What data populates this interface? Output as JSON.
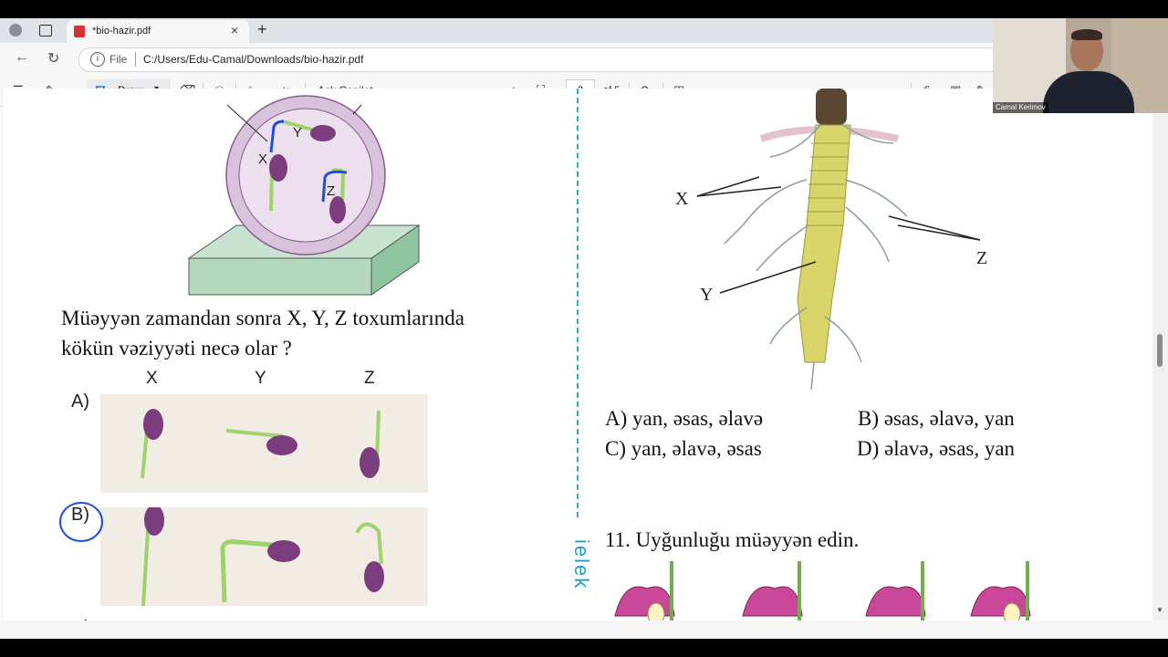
{
  "browser": {
    "tab_title": "*bio-hazir.pdf",
    "url_scheme": "File",
    "url_path": "C:/Users/Edu-Camal/Downloads/bio-hazir.pdf"
  },
  "pdf_toolbar": {
    "draw_label": "Draw",
    "copilot_label": "Ask Copilot",
    "page_current": "3",
    "page_total": "of 5"
  },
  "webcam": {
    "name": "Camal Kerimov"
  },
  "left": {
    "top_labels": {
      "x": "X",
      "y": "Y",
      "z": "Z"
    },
    "question_line1": "Müəyyən zamandan sonra X, Y, Z toxumlarında",
    "question_line2": "kökün vəziyyəti necə olar ?",
    "col_headers": [
      "X",
      "Y",
      "Z"
    ],
    "option_letters": [
      "A)",
      "B)",
      "C)"
    ],
    "selected_option": "B)"
  },
  "right": {
    "plant_labels": {
      "x": "X",
      "y": "Y",
      "z": "Z"
    },
    "options": {
      "a": "A) yan, əsas, əlavə",
      "b": "B) əsas, əlavə, yan",
      "c": "C) yan, əlavə, əsas",
      "d": "D) əlavə, əsas, yan"
    },
    "q11": "11. Uyğunluğu müəyyən edin.",
    "side_text": "ielek"
  },
  "colors": {
    "accent": "#0f6cbd",
    "annotation": "#1a4fd6",
    "divider": "#2aa6cf",
    "seed": "#7b3d7e",
    "root": "#9ed36a",
    "flower": "#c9489a"
  }
}
